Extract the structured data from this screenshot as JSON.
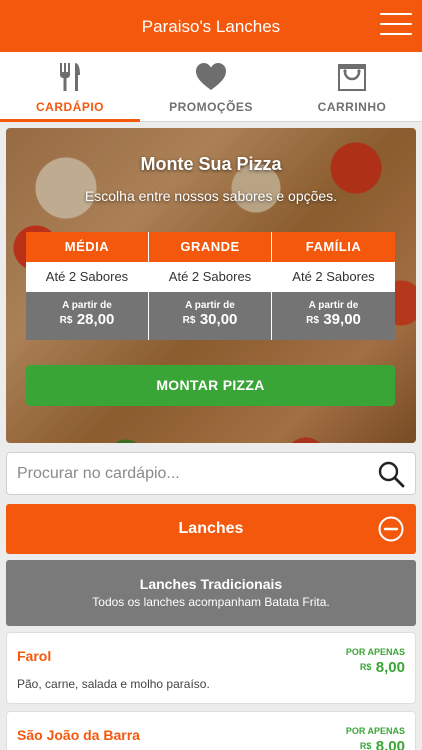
{
  "app": {
    "title": "Paraiso's Lanches"
  },
  "tabs": [
    {
      "label": "CARDÁPIO",
      "icon": "fork-knife-icon",
      "active": true
    },
    {
      "label": "PROMOÇÕES",
      "icon": "heart-icon",
      "active": false
    },
    {
      "label": "CARRINHO",
      "icon": "shopping-bag-icon",
      "active": false
    }
  ],
  "builder": {
    "title": "Monte Sua Pizza",
    "subtitle": "Escolha entre nossos sabores e opções.",
    "sizes": [
      {
        "name": "MÉDIA",
        "flavors": "Até 2 Sabores",
        "from": "A partir de",
        "currency": "R$",
        "price": "28,00"
      },
      {
        "name": "GRANDE",
        "flavors": "Até 2 Sabores",
        "from": "A partir de",
        "currency": "R$",
        "price": "30,00"
      },
      {
        "name": "FAMÍLIA",
        "flavors": "Até 2 Sabores",
        "from": "A partir de",
        "currency": "R$",
        "price": "39,00"
      }
    ],
    "button_label": "MONTAR PIZZA"
  },
  "search": {
    "placeholder": "Procurar no cardápio..."
  },
  "category": {
    "title": "Lanches",
    "state": "expanded"
  },
  "subcategory": {
    "title": "Lanches Tradicionais",
    "description": "Todos os lanches acompanham Batata Frita."
  },
  "items": [
    {
      "name": "Farol",
      "description": "Pão, carne, salada e molho paraíso.",
      "price_prefix": "POR APENAS",
      "currency": "R$",
      "price": "8,00"
    },
    {
      "name": "São João da Barra",
      "description": "",
      "price_prefix": "POR APENAS",
      "currency": "R$",
      "price": "8,00"
    }
  ],
  "colors": {
    "brand_orange": "#f4580d",
    "action_green": "#3aa537",
    "panel_gray": "#7a7a7a"
  }
}
